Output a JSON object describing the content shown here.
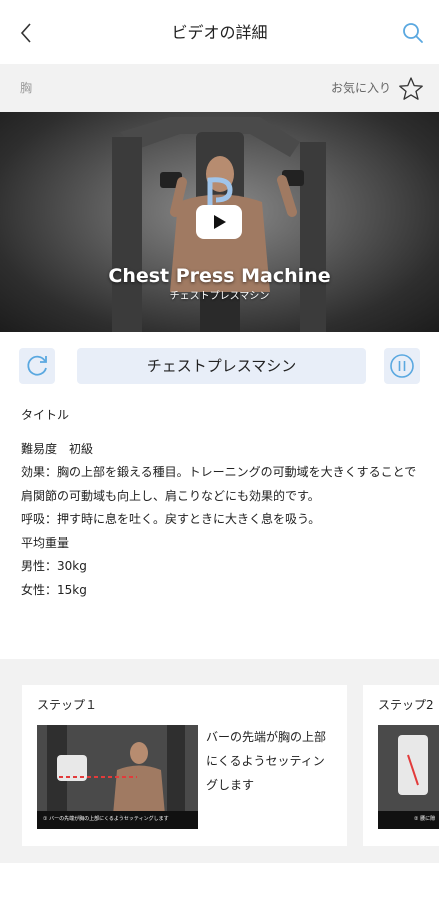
{
  "header": {
    "title": "ビデオの詳細",
    "back_icon": "chevron-left-icon",
    "search_icon": "search-icon"
  },
  "category_bar": {
    "category": "胸",
    "favorite_label": "お気に入り",
    "favorite_icon": "star-outline-icon"
  },
  "video": {
    "title_en": "Chest Press Machine",
    "title_ja": "チェストプレスマシン",
    "play_icon": "play-icon",
    "logo_icon": "brand-logo-icon"
  },
  "controls": {
    "replay_icon": "replay-icon",
    "exercise_name": "チェストプレスマシン",
    "pause_icon": "pause-icon"
  },
  "details": {
    "heading": "タイトル",
    "lines": [
      "難易度　初級",
      "効果：胸の上部を鍛える種目。トレーニングの可動域を大きくすることで",
      "肩関節の可動域も向上し、肩こりなどにも効果的です。",
      "呼吸：押す時に息を吐く。戻すときに大きく息を吸う。",
      "平均重量",
      "男性：30kg",
      "女性：15kg"
    ]
  },
  "steps": [
    {
      "label": "ステップ１",
      "description_lines": [
        "バーの先端が胸の上部",
        "にくるようセッティン",
        "グします"
      ],
      "thumb_caption": "① バーの先端が胸の上部にくるようセッティングします"
    },
    {
      "label": "ステップ2",
      "description_lines": [],
      "thumb_caption": "② 腰に隙"
    }
  ],
  "colors": {
    "accent": "#5aa8e0",
    "control_bg": "#e8eef8",
    "band_bg": "#f2f2f2"
  }
}
